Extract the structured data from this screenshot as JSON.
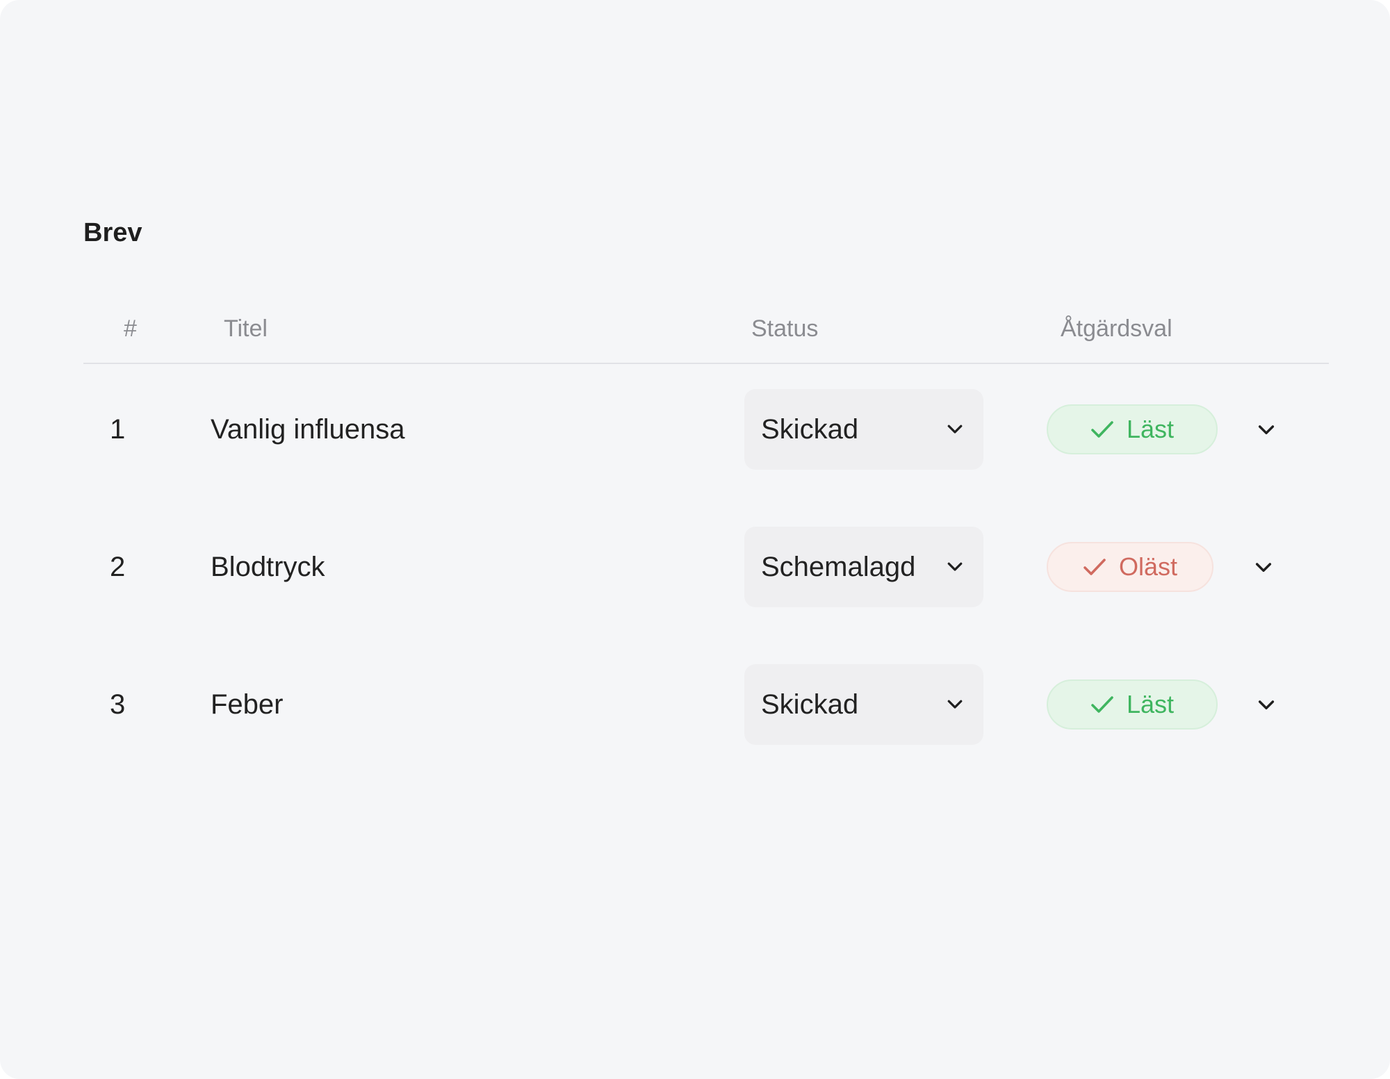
{
  "section": {
    "title": "Brev"
  },
  "table": {
    "headers": {
      "number": "#",
      "title": "Titel",
      "status": "Status",
      "action": "Åtgärdsval"
    },
    "rows": [
      {
        "number": "1",
        "title": "Vanlig influensa",
        "status": "Skickad",
        "badge": "Läst",
        "badge_state": "read"
      },
      {
        "number": "2",
        "title": "Blodtryck",
        "status": "Schemalagd",
        "badge": "Oläst",
        "badge_state": "unread"
      },
      {
        "number": "3",
        "title": "Feber",
        "status": "Skickad",
        "badge": "Läst",
        "badge_state": "read"
      }
    ]
  },
  "icons": {
    "dropdown": "chevron-down-icon",
    "check": "check-icon"
  },
  "colors": {
    "background": "#f5f6f8",
    "read_text": "#3fb55f",
    "read_bg": "#e5f5e8",
    "unread_text": "#d06a5f",
    "unread_bg": "#fbefec",
    "select_bg": "#efeff1"
  }
}
